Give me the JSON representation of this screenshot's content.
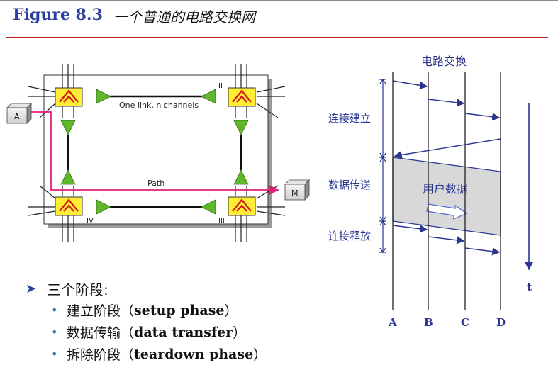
{
  "header": {
    "figure_number": "Figure 8.3",
    "figure_title": "一个普通的电路交换网"
  },
  "network": {
    "station_a": "A",
    "station_m": "M",
    "switch_labels": [
      "I",
      "II",
      "III",
      "IV"
    ],
    "link_label": "One link, n channels",
    "path_label": "Path"
  },
  "timing": {
    "title": "电路交换",
    "phase_setup": "连接建立",
    "phase_transfer": "数据传送",
    "phase_release": "连接释放",
    "data_box": "用户数据",
    "time_label": "t",
    "nodes": [
      "A",
      "B",
      "C",
      "D"
    ]
  },
  "stages": {
    "heading": "三个阶段:",
    "items": [
      {
        "zh": "建立阶段",
        "open": "（",
        "en": "setup phase",
        "close": "）"
      },
      {
        "zh": "数据传输",
        "open": "（",
        "en": "data transfer",
        "close": "）"
      },
      {
        "zh": "拆除阶段",
        "open": "（",
        "en": "teardown phase",
        "close": "）"
      }
    ]
  },
  "colors": {
    "title_blue": "#2a3f9e",
    "accent_red": "#c0201a",
    "path_magenta": "#e0207a",
    "switch_yellow": "#ffee33",
    "arrow_green": "#5fb82a",
    "timing_blue": "#2a3590"
  }
}
